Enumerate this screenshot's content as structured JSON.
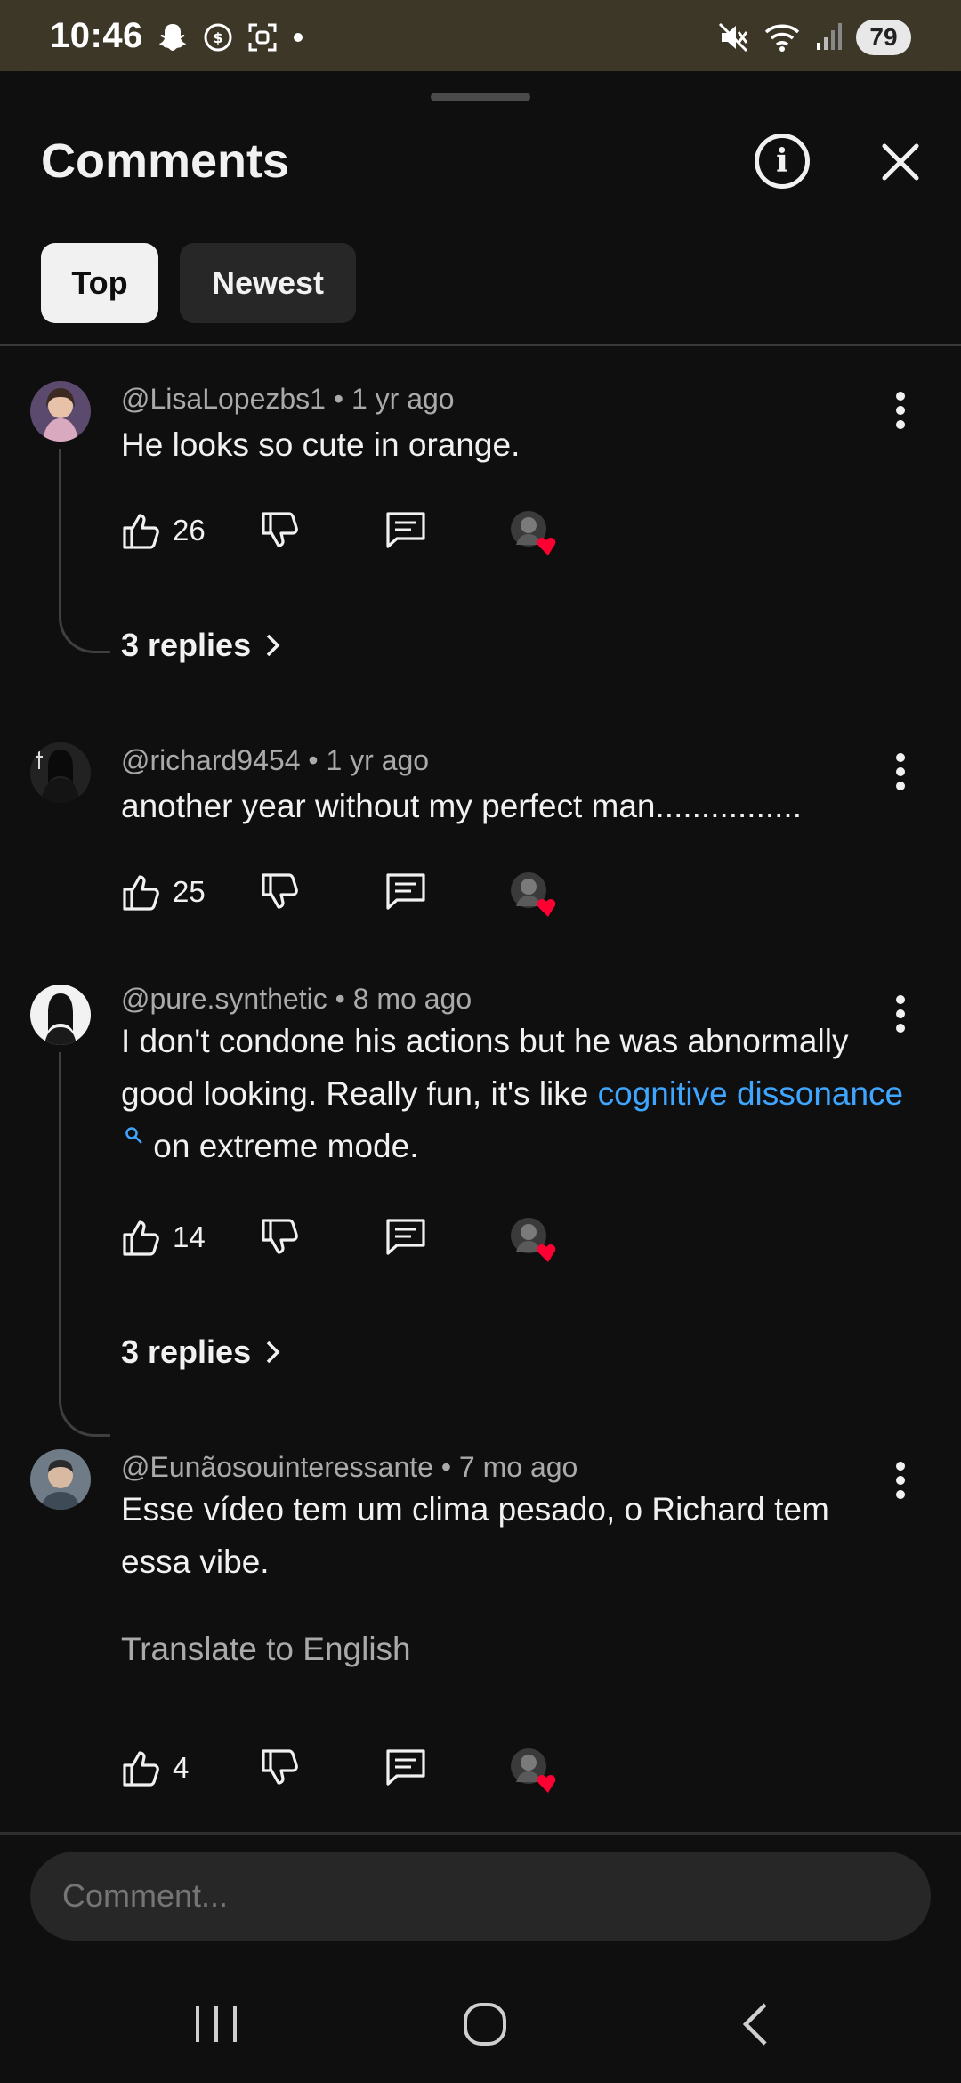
{
  "status_bar": {
    "time": "10:46",
    "battery": "79",
    "left_icons": [
      "snapchat-icon",
      "notification-icon",
      "screenshot-icon",
      "dot-icon"
    ],
    "right_icons": [
      "mute-icon",
      "wifi-icon",
      "signal-icon"
    ]
  },
  "header": {
    "title": "Comments"
  },
  "filters": {
    "top": "Top",
    "newest": "Newest",
    "selected": "Top"
  },
  "comments": [
    {
      "meta": "@LisaLopezbs1 • 1 yr ago",
      "text": "He looks so cute in orange.",
      "likes": "26",
      "replies": "3 replies"
    },
    {
      "meta": "@richard9454 • 1 yr ago",
      "text": "another year without my perfect man................",
      "likes": "25"
    },
    {
      "meta": "@pure.synthetic • 8 mo ago",
      "text_before": "I don't condone his actions but he was abnormally good looking. Really fun, it's like ",
      "link": "cognitive dissonance",
      "text_after": " on extreme mode.",
      "likes": "14",
      "replies": "3 replies"
    },
    {
      "meta": "@Eunãosouinteressante • 7 mo ago",
      "text": "Esse vídeo tem um clima pesado, o Richard tem essa vibe.",
      "translate": "Translate to English",
      "likes": "4"
    }
  ],
  "input": {
    "placeholder": "Comment..."
  },
  "colors": {
    "background": "#0f0f0f",
    "status_bar": "#3d3728",
    "link": "#3ea6ff",
    "heart": "#ff0033"
  }
}
